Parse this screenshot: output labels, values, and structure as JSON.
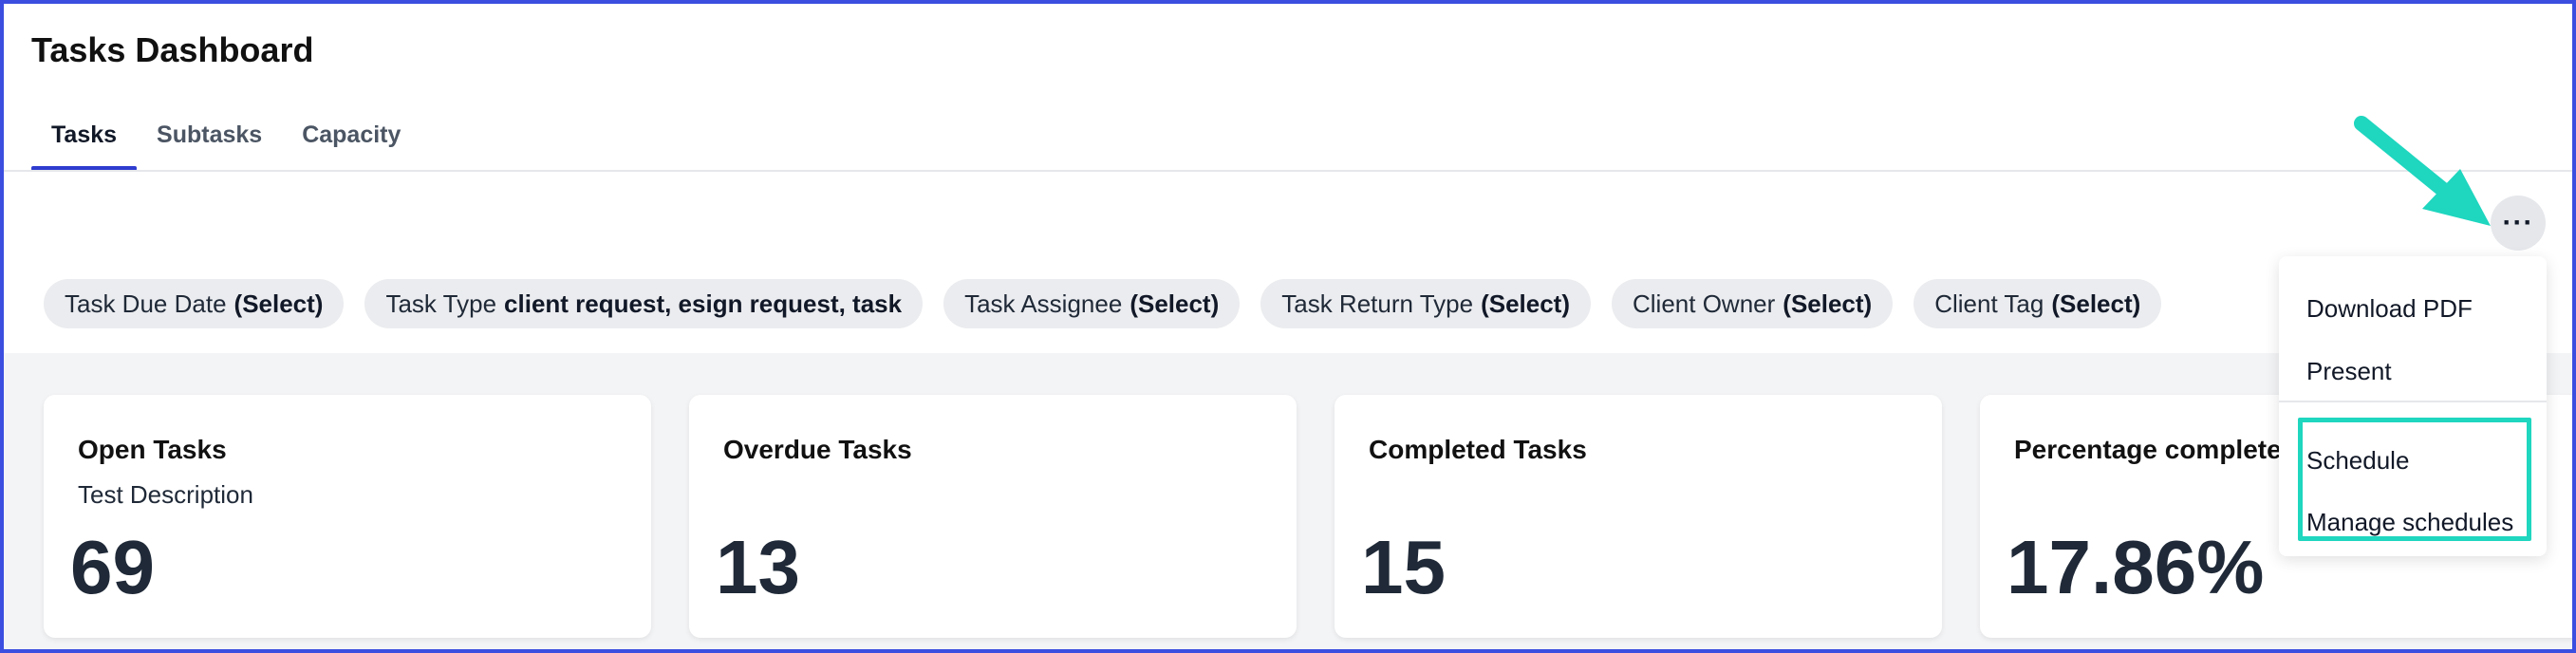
{
  "header": {
    "title": "Tasks Dashboard"
  },
  "tabs": [
    {
      "label": "Tasks",
      "active": true
    },
    {
      "label": "Subtasks",
      "active": false
    },
    {
      "label": "Capacity",
      "active": false
    }
  ],
  "filters": [
    {
      "label": "Task Due Date",
      "value": "(Select)"
    },
    {
      "label": "Task Type",
      "value": "client request, esign request, task"
    },
    {
      "label": "Task Assignee",
      "value": "(Select)"
    },
    {
      "label": "Task Return Type",
      "value": "(Select)"
    },
    {
      "label": "Client Owner",
      "value": "(Select)"
    },
    {
      "label": "Client Tag",
      "value": "(Select)"
    }
  ],
  "cards": [
    {
      "title": "Open Tasks",
      "description": "Test Description",
      "value": "69"
    },
    {
      "title": "Overdue Tasks",
      "description": "",
      "value": "13"
    },
    {
      "title": "Completed Tasks",
      "description": "",
      "value": "15"
    },
    {
      "title": "Percentage complete",
      "description": "",
      "value": "17.86%"
    }
  ],
  "more_button": {
    "label": "···",
    "icon": "more-horizontal-icon"
  },
  "menu": {
    "items": [
      "Download PDF",
      "Present",
      "Schedule",
      "Manage schedules"
    ]
  },
  "annotation": {
    "color": "#1fd6bf",
    "icon": "pointer-arrow"
  },
  "colors": {
    "accent": "#2f3ccf",
    "frame": "#3b4ee0"
  }
}
